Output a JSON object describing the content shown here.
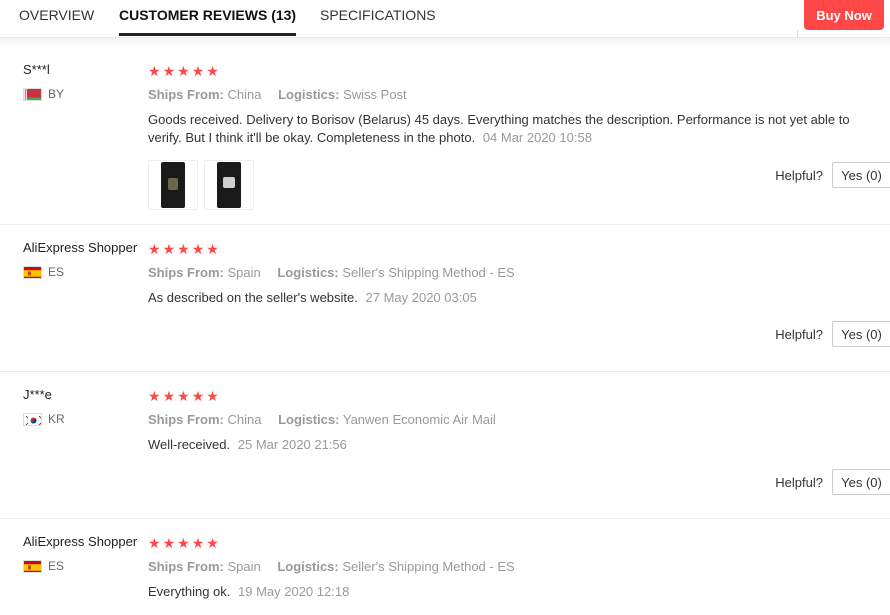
{
  "tabs": [
    {
      "label": "OVERVIEW"
    },
    {
      "label": "CUSTOMER REVIEWS (13)"
    },
    {
      "label": "SPECIFICATIONS"
    }
  ],
  "buy_now": "Buy Now",
  "accent_color": "#ff4747",
  "helpful_label": "Helpful?",
  "ships_from_label": "Ships From:",
  "logistics_label": "Logistics:",
  "reviews": [
    {
      "user": "S***l",
      "country": "BY",
      "flag": "belarus-flag-icon",
      "stars": 5,
      "ships_from": "China",
      "logistics": "Swiss Post",
      "text": "Goods received. Delivery to Borisov (Belarus) 45 days. Everything matches the description. Performance is not yet able to verify. But I think it'll be okay. Completeness in the photo.",
      "date": "04 Mar 2020 10:58",
      "yes": "Yes (0)"
    },
    {
      "user": "AliExpress Shopper",
      "country": "ES",
      "flag": "spain-flag-icon",
      "stars": 5,
      "ships_from": "Spain",
      "logistics": "Seller's Shipping Method - ES",
      "text": "As described on the seller's website.",
      "date": "27 May 2020 03:05",
      "yes": "Yes (0)"
    },
    {
      "user": "J***e",
      "country": "KR",
      "flag": "south-korea-flag-icon",
      "stars": 5,
      "ships_from": "China",
      "logistics": "Yanwen Economic Air Mail",
      "text": "Well-received.",
      "date": "25 Mar 2020 21:56",
      "yes": "Yes (0)"
    },
    {
      "user": "AliExpress Shopper",
      "country": "ES",
      "flag": "spain-flag-icon",
      "stars": 5,
      "ships_from": "Spain",
      "logistics": "Seller's Shipping Method - ES",
      "text": "Everything ok.",
      "date": "19 May 2020 12:18"
    }
  ]
}
